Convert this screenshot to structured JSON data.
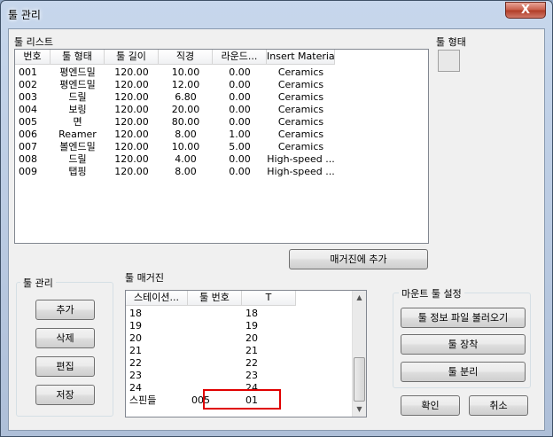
{
  "window": {
    "title": "툴 관리",
    "close_label": "X"
  },
  "tool_list": {
    "label": "툴 리스트",
    "columns": [
      "번호",
      "툴 형태",
      "툴 길이",
      "직경",
      "라운드...",
      "Insert Material"
    ],
    "rows": [
      [
        "001",
        "평엔드밀",
        "120.00",
        "10.00",
        "0.00",
        "Ceramics"
      ],
      [
        "002",
        "평엔드밀",
        "120.00",
        "12.00",
        "0.00",
        "Ceramics"
      ],
      [
        "003",
        "드릴",
        "120.00",
        "6.80",
        "0.00",
        "Ceramics"
      ],
      [
        "004",
        "보링",
        "120.00",
        "20.00",
        "0.00",
        "Ceramics"
      ],
      [
        "005",
        "면",
        "120.00",
        "80.00",
        "0.00",
        "Ceramics"
      ],
      [
        "006",
        "Reamer",
        "120.00",
        "8.00",
        "1.00",
        "Ceramics"
      ],
      [
        "007",
        "볼엔드밀",
        "120.00",
        "10.00",
        "5.00",
        "Ceramics"
      ],
      [
        "008",
        "드릴",
        "120.00",
        "4.00",
        "0.00",
        "High-speed ..."
      ],
      [
        "009",
        "탭핑",
        "120.00",
        "8.00",
        "0.00",
        "High-speed ..."
      ]
    ]
  },
  "tool_shape": {
    "label": "툴 형태"
  },
  "add_to_magazine_label": "매거진에 추가",
  "tool_manage": {
    "label": "툴 관리",
    "add": "추가",
    "delete": "삭제",
    "edit": "편집",
    "save": "저장"
  },
  "magazine": {
    "label": "툴 매거진",
    "columns": [
      "스테이션...",
      "툴 번호",
      "T"
    ],
    "rows": [
      [
        "18",
        "",
        "18"
      ],
      [
        "19",
        "",
        "19"
      ],
      [
        "20",
        "",
        "20"
      ],
      [
        "21",
        "",
        "21"
      ],
      [
        "22",
        "",
        "22"
      ],
      [
        "23",
        "",
        "23"
      ],
      [
        "24",
        "",
        "24"
      ],
      [
        "스핀들",
        "005",
        "01"
      ]
    ]
  },
  "mount": {
    "label": "마운트 툴 설정",
    "load_file": "툴 정보 파일 불러오기",
    "attach": "툴 장착",
    "detach": "툴 분리"
  },
  "ok_label": "확인",
  "cancel_label": "취소",
  "colors": {
    "highlight_box": "#e00000"
  }
}
